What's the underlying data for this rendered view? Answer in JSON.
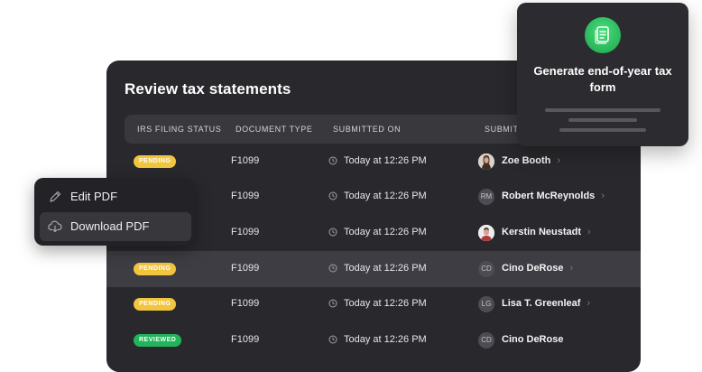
{
  "panel": {
    "title": "Review tax statements",
    "columns": [
      "IRS FILING STATUS",
      "DOCUMENT TYPE",
      "SUBMITTED ON",
      "SUBMIT"
    ],
    "rows": [
      {
        "status": "PENDING",
        "status_color": "#f2c53f",
        "doc_type": "F1099",
        "submitted_on": "Today at 12:26 PM",
        "submitter": "Zoe Booth",
        "avatar_initials": ""
      },
      {
        "status": "",
        "status_color": "",
        "doc_type": "F1099",
        "submitted_on": "Today at 12:26 PM",
        "submitter": "Robert McReynolds",
        "avatar_initials": "RM"
      },
      {
        "status": "",
        "status_color": "",
        "doc_type": "F1099",
        "submitted_on": "Today at 12:26 PM",
        "submitter": "Kerstin Neustadt",
        "avatar_initials": ""
      },
      {
        "status": "PENDING",
        "status_color": "#f2c53f",
        "doc_type": "F1099",
        "submitted_on": "Today at 12:26 PM",
        "submitter": "Cino DeRose",
        "avatar_initials": "CD"
      },
      {
        "status": "PENDING",
        "status_color": "#f2c53f",
        "doc_type": "F1099",
        "submitted_on": "Today at 12:26 PM",
        "submitter": "Lisa T. Greenleaf",
        "avatar_initials": "LG"
      },
      {
        "status": "REVIEWED",
        "status_color": "#22b45a",
        "doc_type": "F1099",
        "submitted_on": "Today at 12:26 PM",
        "submitter": "Cino DeRose",
        "avatar_initials": "CD"
      }
    ],
    "chevron": "›",
    "icons": {
      "clock": "clock-icon",
      "chevron": "chevron-right-icon"
    }
  },
  "context_menu": {
    "items": [
      {
        "label": "Edit PDF",
        "icon": "pencil-icon"
      },
      {
        "label": "Download PDF",
        "icon": "cloud-download-icon"
      }
    ]
  },
  "card": {
    "title": "Generate end-of-year tax form",
    "icon": "document-icon",
    "accent_color": "#2fc15f"
  },
  "colors": {
    "panel_bg": "#29292d",
    "header_bg": "#38383d",
    "highlight_row": "#3d3d43",
    "pending": "#f2c53f",
    "reviewed": "#22b45a"
  }
}
